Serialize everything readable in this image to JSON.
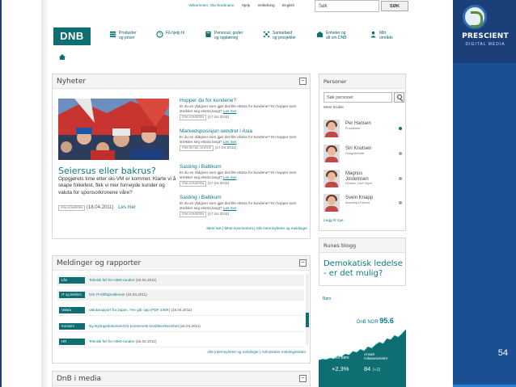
{
  "top": {
    "user_greeting": "Velkommen, Ola Nordmann",
    "links": [
      "Hjelp",
      "Veiledning",
      "English"
    ],
    "search_value": "Søk",
    "search_button": "SØK"
  },
  "brand": {
    "logo": "DNB",
    "accent": "#0e6e72"
  },
  "nav": [
    {
      "icon": "stack-icon",
      "label1": "Produkter",
      "label2": "og priser"
    },
    {
      "icon": "help-circle-icon",
      "label1": "Få hjelp til",
      "label2": ""
    },
    {
      "icon": "book-icon",
      "label1": "Personal, goder",
      "label2": "og opplæring"
    },
    {
      "icon": "network-icon",
      "label1": "Samarbeid",
      "label2": "og prosjekter"
    },
    {
      "icon": "building-icon",
      "label1": "Enheter og",
      "label2": "alt om DNB"
    },
    {
      "icon": "person-icon",
      "label1": "Mitt",
      "label2": "område"
    }
  ],
  "news": {
    "title": "Nyheter",
    "feature": {
      "headline": "Seiersus eller bakrus?",
      "text": "Oppgjørets time etter ski-VM er kommet. Klarte vi å skape folkefest, fikk vi mer forneyde kunder og valuta for sponsorkronene våre?",
      "tag": "FRA KONSERN",
      "date": "(18.04.2011)",
      "more": "Les mer"
    },
    "items": [
      {
        "headline": "Hopper du for kundene?",
        "body": "Er du en rådgiver som gjør det lille ekstra for kundene? En hopper som strekker seg ekstra langt?",
        "more": "Les mer",
        "tag": "FRA KONSERN",
        "date": "(17.04.2011)"
      },
      {
        "headline": "Markedsposisjon uendret i Asia",
        "body": "Er du en rådgiver som gjør det lille ekstra for kundene? En hopper som strekker seg ekstra langt?",
        "more": "Les mer",
        "tag": "FRA RETAIL NORGE",
        "date": "(17.04.2011)"
      },
      {
        "headline": "Sasting i Baltikum",
        "body": "Er du en rådgiver som gjør det lille ekstra for kundene? En hopper som strekker seg ekstra langt?",
        "more": "Les mer",
        "tag": "FRA KONSERN",
        "date": "(17.04.2011)"
      },
      {
        "headline": "Sasting i Baltikum",
        "body": "Er du en rådgiver som gjør det lille ekstra for kundene? En hopper som strekker seg ekstra langt?",
        "more": "Les mer",
        "tag": "FRA KONSERN",
        "date": "(17.04.2011)"
      }
    ],
    "footer": "Mest lest | Mest kommentert | Alle internnyheter og meldinger"
  },
  "messages": {
    "title": "Meldinger og rapporter",
    "rows": [
      {
        "badge": "Lån",
        "text": "Teknisk feil for HMS-runden",
        "date": "(16.04.2011)"
      },
      {
        "badge": "IT og telefoni",
        "text": "Om IT-driftsproblemer",
        "date": "(16.04.2011)"
      },
      {
        "badge": "Valuta",
        "text": "Valutarapport fra Japan. Yen går opp (PDF 246K)",
        "date": "(16.04.2011)"
      },
      {
        "badge": "Konsern",
        "text": "Ny styringsdokument for konsernets kredittverksomhet",
        "date": "(16.04.2011)"
      },
      {
        "badge": "HR",
        "text": "Teknisk feil for HMS-runden",
        "date": "(16.04.2011)"
      }
    ],
    "footer": "Alle internnyheter og meldinger | Administrer meldingsstrøm"
  },
  "media": {
    "title": "DnB i media"
  },
  "people": {
    "title": "Personer",
    "search_placeholder": "Søk personer",
    "most_used": "Mest brukte",
    "list": [
      {
        "name1": "Per Hansen",
        "name2": "",
        "role": "Produkteier",
        "status_color": "#0e6e72"
      },
      {
        "name1": "Siri Knutsen",
        "name2": "",
        "role": "Designdirektør",
        "status_color": "#9aa3a8"
      },
      {
        "name1": "Magnus",
        "name2": "Jostelnsen",
        "role": "Direktør, Cash Mgmt",
        "status_color": "#9aa3a8"
      },
      {
        "name1": "Svein Knapp",
        "name2": "",
        "role": "Ansvarlig eFaktura",
        "status_color": "#9aa3a8"
      }
    ],
    "add": "Legg til nye"
  },
  "blog": {
    "title": "Runes blogg",
    "post": "Demokatisk ledelse - er det mulig?"
  },
  "stock": {
    "label": "Børs",
    "name": "DnB NOR",
    "value": "95.6",
    "left_label": "Oslo børs",
    "left_value": "+2,3%",
    "right_label": "Ansatt mileparameter",
    "right_value": "84",
    "right_delta": "(+2)",
    "line": [
      10,
      12,
      11,
      14,
      13,
      18,
      16,
      22,
      20,
      27,
      25,
      31,
      28,
      36,
      33,
      40,
      45,
      42,
      52,
      50,
      58,
      55,
      62,
      70
    ]
  },
  "slide": {
    "brand": "PRESCIENT",
    "brand_sub": "DIGITAL MEDIA",
    "number": "54"
  }
}
